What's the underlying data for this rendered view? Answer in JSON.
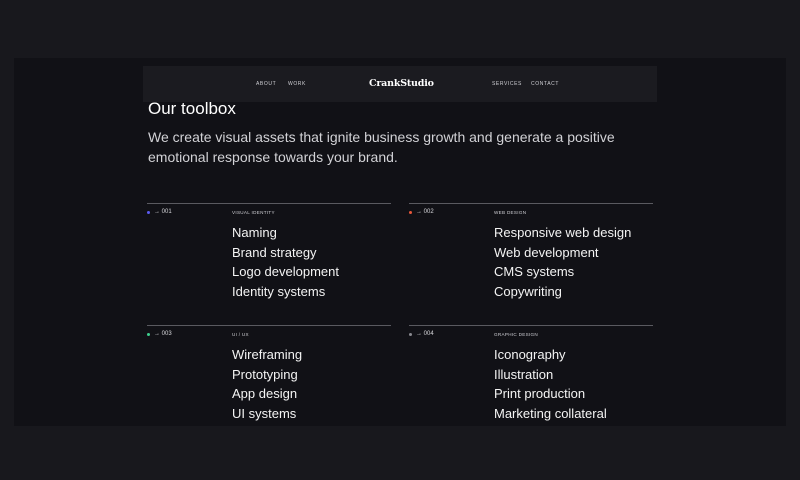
{
  "nav": {
    "left_links": [
      "ABOUT",
      "WORK"
    ],
    "logo": "CrankStudio",
    "right_links": [
      "SERVICES",
      "CONTACT"
    ]
  },
  "section": {
    "title": "Our toolbox",
    "intro": "We create visual assets that ignite business growth and generate a positive emotional response towards your brand."
  },
  "services": [
    {
      "index": "→ 001",
      "dot_color": "#5b5bf0",
      "category": "VISUAL IDENTITY",
      "items": [
        "Naming",
        "Brand strategy",
        "Logo development",
        "Identity systems"
      ]
    },
    {
      "index": "→ 002",
      "dot_color": "#e8573a",
      "category": "WEB DESIGN",
      "items": [
        "Responsive web design",
        "Web development",
        "CMS systems",
        "Copywriting"
      ]
    },
    {
      "index": "→ 003",
      "dot_color": "#3ecf8e",
      "category": "UI / UX",
      "items": [
        "Wireframing",
        "Prototyping",
        "App design",
        "UI systems"
      ]
    },
    {
      "index": "→ 004",
      "dot_color": "#8a8a90",
      "category": "GRAPHIC DESIGN",
      "items": [
        "Iconography",
        "Illustration",
        "Print production",
        "Marketing collateral"
      ]
    }
  ]
}
